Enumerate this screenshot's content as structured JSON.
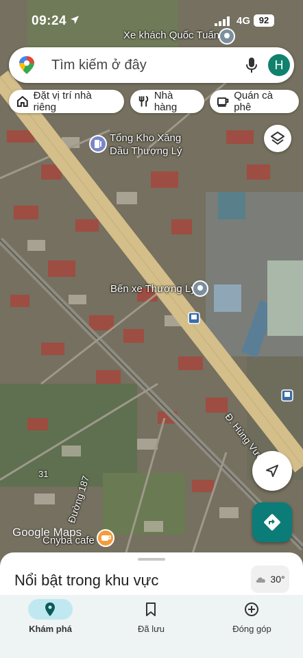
{
  "status_bar": {
    "time": "09:24",
    "network": "4G",
    "battery": "92"
  },
  "search": {
    "placeholder": "Tìm kiếm ở đây",
    "avatar_letter": "H"
  },
  "chips": [
    {
      "label": "Đặt vị trí nhà riêng",
      "icon": "home-icon"
    },
    {
      "label": "Nhà hàng",
      "icon": "restaurant-icon"
    },
    {
      "label": "Quán cà phê",
      "icon": "coffee-icon"
    }
  ],
  "map_labels": {
    "bus_company": "Xe khách Quốc Tuấn",
    "fuel_depot_line1": "Tổng Kho Xăng",
    "fuel_depot_line2": "Dầu Thượng Lý",
    "bus_station": "Bến xe Thượng Lý",
    "main_road": "Đ. Hùng Vương",
    "side_road": "Đường 187",
    "road_number": "31",
    "cafe": "Cnyba cafe"
  },
  "watermark": "Google Maps",
  "sheet": {
    "title": "Nổi bật trong khu vực"
  },
  "weather": {
    "temp": "30°",
    "icon": "cloud-icon"
  },
  "bottom_nav": [
    {
      "label": "Khám phá",
      "icon": "explore-pin-icon",
      "active": true
    },
    {
      "label": "Đã lưu",
      "icon": "bookmark-icon",
      "active": false
    },
    {
      "label": "Đóng góp",
      "icon": "add-circle-icon",
      "active": false
    }
  ],
  "colors": {
    "accent": "#0b7c78",
    "avatar": "#10816c",
    "nav_active": "#c0e8f0",
    "road": "#d4be8a"
  }
}
